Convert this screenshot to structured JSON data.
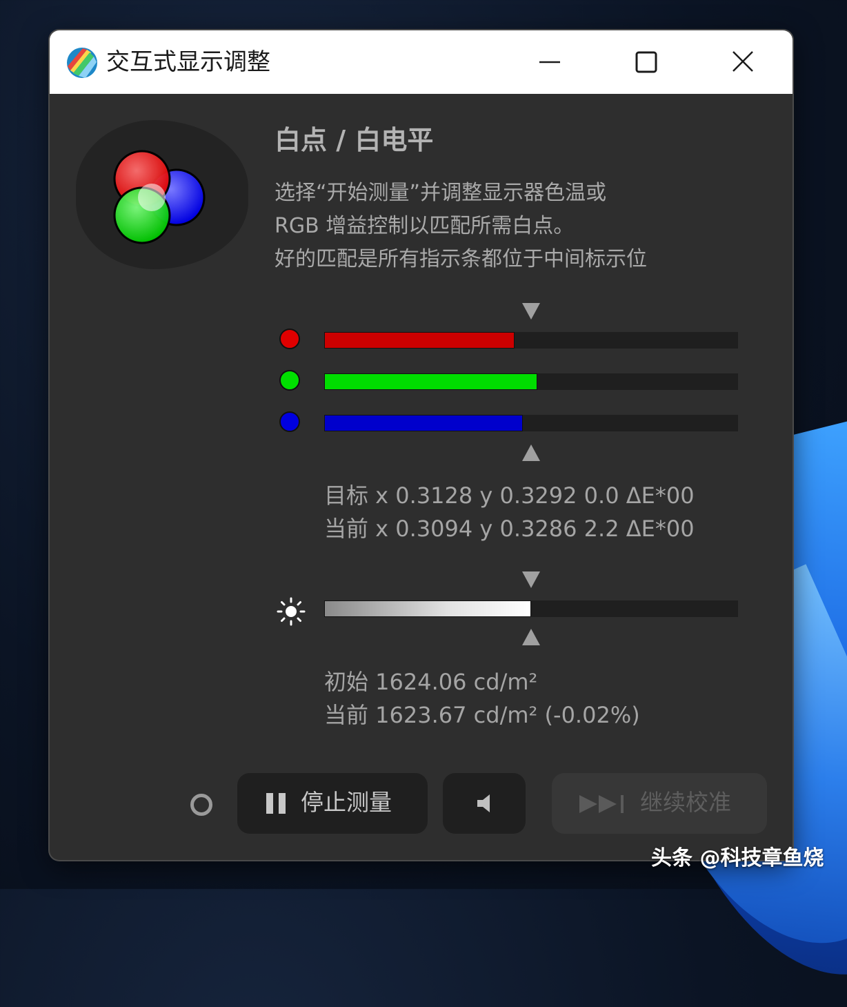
{
  "window": {
    "title": "交互式显示调整",
    "app_icon": "displaycal-icon"
  },
  "titlebar_controls": {
    "minimize_icon": "minimize-icon",
    "maximize_icon": "maximize-icon",
    "close_icon": "close-icon"
  },
  "panel": {
    "logo_icon": "rgb-circles-icon",
    "heading": "白点 / 白电平",
    "description_lines": [
      "选择“开始测量”并调整显示器色温或",
      "RGB 增益控制以匹配所需白点。",
      "好的匹配是所有指示条都位于中间标示位"
    ]
  },
  "rgb_bars": [
    {
      "channel": "red",
      "color": "#e00000",
      "fill_color": "#cc0000",
      "level": 0.46
    },
    {
      "channel": "green",
      "color": "#00e000",
      "fill_color": "#00dd00",
      "level": 0.515
    },
    {
      "channel": "blue",
      "color": "#0000e0",
      "fill_color": "#0000cc",
      "level": 0.48
    }
  ],
  "chromaticity": {
    "target": "目标 x 0.3128 y 0.3292 0.0 ΔE*00",
    "current": "当前 x 0.3094 y 0.3286 2.2 ΔE*00"
  },
  "luminance_bar": {
    "icon": "brightness-sun-icon",
    "level": 0.5
  },
  "luminance": {
    "initial": "初始 1624.06 cd/m²",
    "current": "当前 1623.67 cd/m² (-0.02%)"
  },
  "buttons": {
    "stop_label": "停止测量",
    "stop_icon": "pause-icon",
    "sound_icon": "speaker-icon",
    "continue_label": "继续校准",
    "continue_icon": "skip-forward-icon"
  },
  "status_icon": "status-ring-icon",
  "watermark": "头条 @科技章鱼烧"
}
